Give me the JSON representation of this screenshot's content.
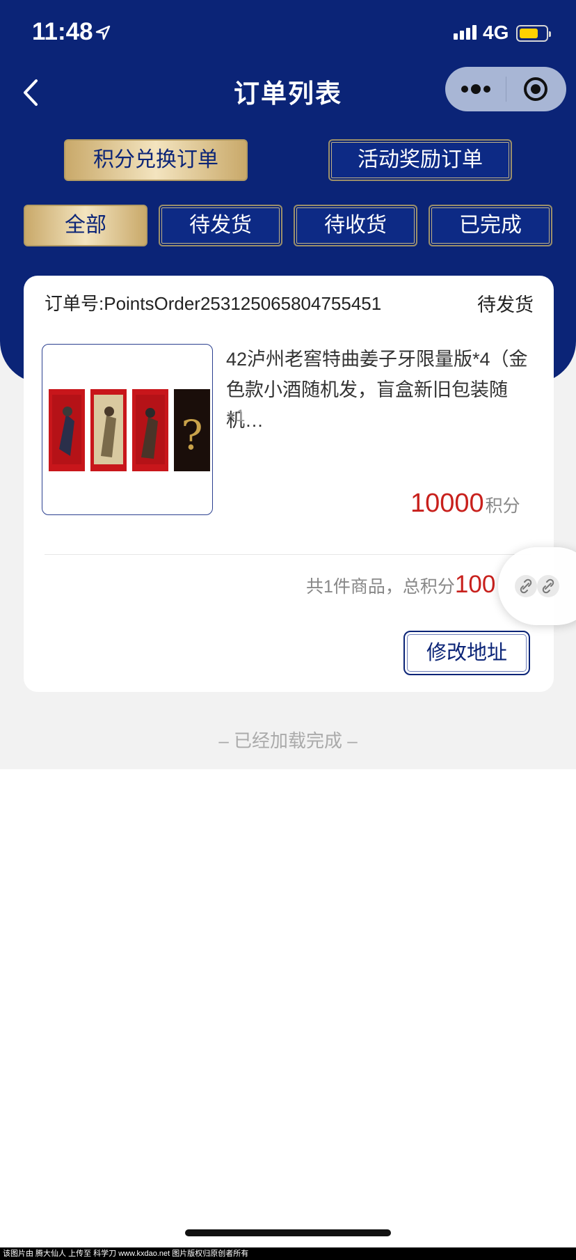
{
  "status_bar": {
    "time": "11:48",
    "network": "4G"
  },
  "nav": {
    "title": "订单列表"
  },
  "order_type_tabs": [
    {
      "label": "积分兑换订单",
      "active": true
    },
    {
      "label": "活动奖励订单",
      "active": false
    }
  ],
  "status_tabs": [
    {
      "label": "全部",
      "active": true
    },
    {
      "label": "待发货",
      "active": false
    },
    {
      "label": "待收货",
      "active": false
    },
    {
      "label": "已完成",
      "active": false
    }
  ],
  "order": {
    "order_no": "订单号:PointsOrder253125065804755451",
    "status": "待发货",
    "product_name": "42泸州老窖特曲姜子牙限量版*4（金色款小酒随机发，盲盒新旧包装随机…",
    "quantity": "×1",
    "price": "10000",
    "price_unit": "积分",
    "summary_label": "共1件商品，总积分",
    "summary_value": "100",
    "modify_address_label": "修改地址"
  },
  "footer": {
    "loaded_text": "–   已经加载完成   –"
  },
  "watermark": "该图片由 腾大仙人 上传至 科学刀 www.kxdao.net 图片版权归原创者所有",
  "colors": {
    "navy": "#0b2477",
    "gold": "#c9a96a",
    "price_red": "#c8201c"
  }
}
